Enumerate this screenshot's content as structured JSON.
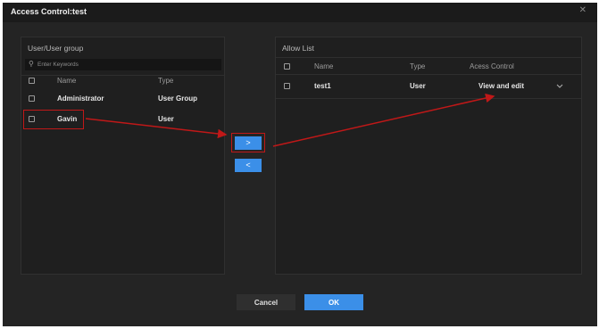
{
  "dialog": {
    "title": "Access Control:test",
    "close_glyph": "✕"
  },
  "left_panel": {
    "title": "User/User group",
    "search_placeholder": "Enter Keywords",
    "columns": [
      "Name",
      "Type"
    ],
    "rows": [
      {
        "name": "Administrator",
        "type": "User Group"
      },
      {
        "name": "Gavin",
        "type": "User"
      }
    ]
  },
  "right_panel": {
    "title": "Allow List",
    "columns": [
      "Name",
      "Type",
      "Acess Control"
    ],
    "rows": [
      {
        "name": "test1",
        "type": "User",
        "access": "View and edit"
      }
    ]
  },
  "transfer": {
    "add_glyph": ">",
    "remove_glyph": "<"
  },
  "footer": {
    "cancel_label": "Cancel",
    "ok_label": "OK"
  },
  "colors": {
    "accent": "#3b8fe8",
    "highlight": "#c01818",
    "background": "#242424"
  },
  "icons": {
    "search": "search-icon",
    "close": "close-icon",
    "dropdown": "chevron-down-icon"
  }
}
